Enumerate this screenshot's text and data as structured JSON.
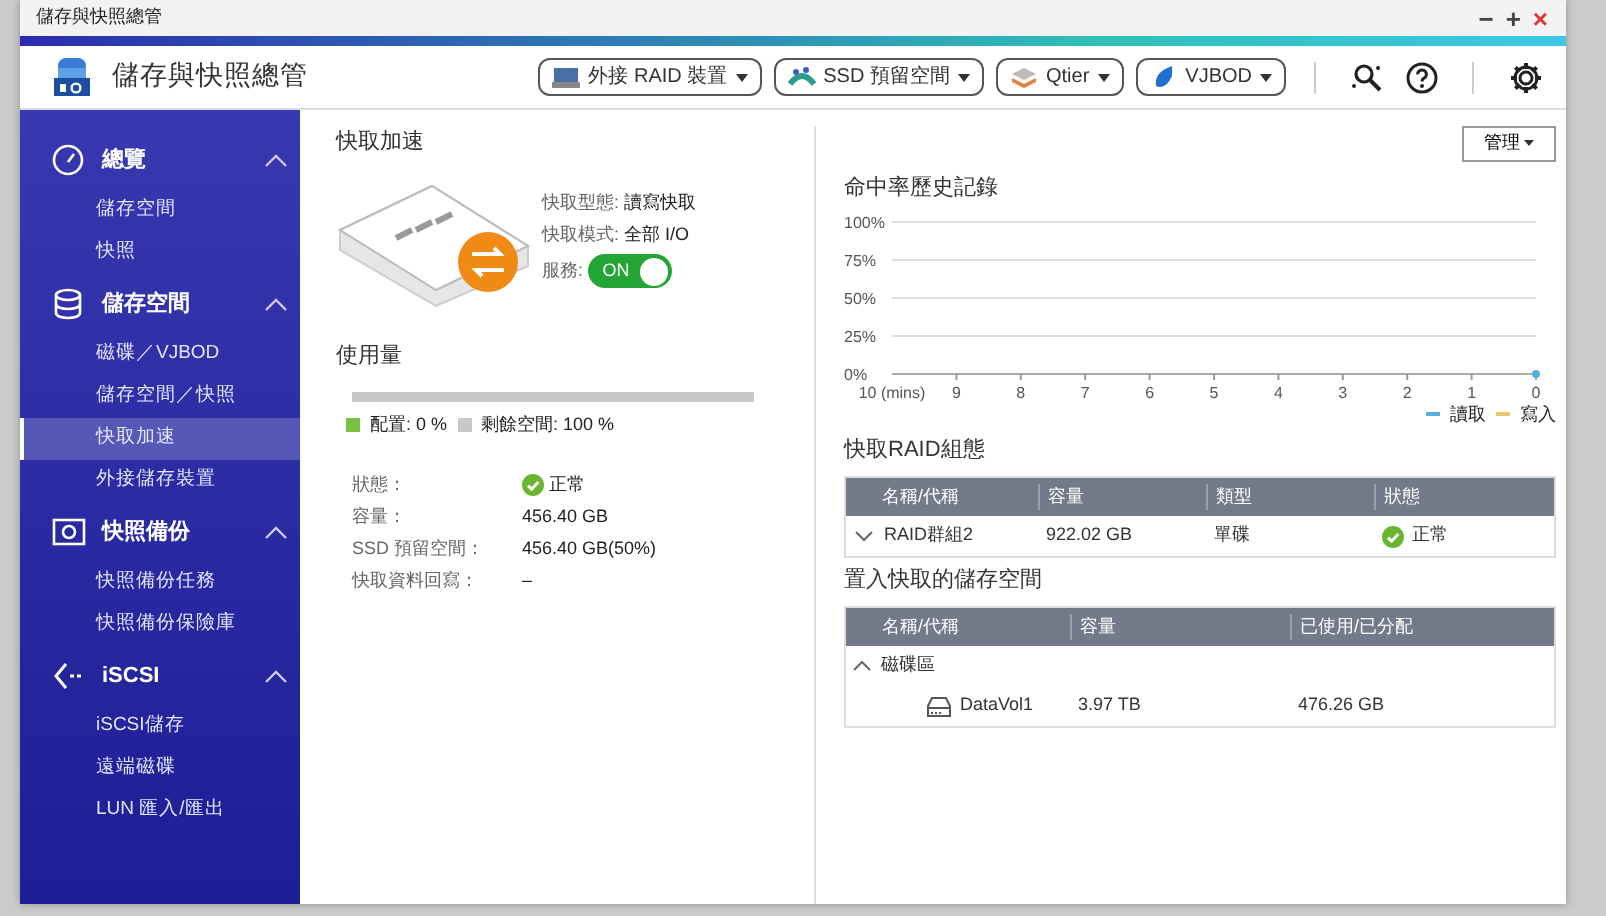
{
  "window": {
    "title": "儲存與快照總管",
    "controls": [
      "−",
      "+",
      "×"
    ]
  },
  "header": {
    "app_title": "儲存與快照總管",
    "menus": [
      {
        "label": "外接 RAID 裝置"
      },
      {
        "label": "SSD 預留空間"
      },
      {
        "label": "Qtier"
      },
      {
        "label": "VJBOD"
      }
    ]
  },
  "sidebar": {
    "sections": [
      {
        "label": "總覽",
        "expanded": true,
        "items": [
          {
            "label": "儲存空間",
            "selected": false
          },
          {
            "label": "快照",
            "selected": false
          }
        ]
      },
      {
        "label": "儲存空間",
        "expanded": true,
        "items": [
          {
            "label": "磁碟／VJBOD",
            "selected": false
          },
          {
            "label": "儲存空間／快照",
            "selected": false
          },
          {
            "label": "快取加速",
            "selected": true
          },
          {
            "label": "外接儲存裝置",
            "selected": false
          }
        ]
      },
      {
        "label": "快照備份",
        "expanded": true,
        "items": [
          {
            "label": "快照備份任務",
            "selected": false
          },
          {
            "label": "快照備份保險庫",
            "selected": false
          }
        ]
      },
      {
        "label": "iSCSI",
        "expanded": true,
        "items": [
          {
            "label": "iSCSI儲存",
            "selected": false
          },
          {
            "label": "遠端磁碟",
            "selected": false
          },
          {
            "label": "LUN 匯入/匯出",
            "selected": false
          }
        ]
      }
    ]
  },
  "main": {
    "title": "快取加速",
    "manage_button": "管理",
    "cache_info": [
      {
        "label": "快取型態:",
        "value": "讀寫快取",
        "kind": "text"
      },
      {
        "label": "快取模式:",
        "value": "全部 I/O",
        "kind": "text"
      },
      {
        "label": "服務:",
        "value": "ON",
        "kind": "toggle",
        "on": true
      }
    ],
    "usage": {
      "title": "使用量",
      "level": 0,
      "legend": [
        {
          "label": "配置:",
          "value": "0 %",
          "color": "#7ac142"
        },
        {
          "label": "剩餘空間:",
          "value": "100 %",
          "color": "#c8c8c8"
        }
      ]
    },
    "details": [
      {
        "label": "狀態：",
        "value": "正常",
        "kind": "status"
      },
      {
        "label": "容量：",
        "value": "456.40 GB",
        "kind": "text"
      },
      {
        "label": "SSD 預留空間：",
        "value": "456.40 GB(50%)",
        "kind": "text"
      },
      {
        "label": "快取資料回寫：",
        "value": "–",
        "kind": "text"
      }
    ],
    "hit_history": {
      "title": "命中率歷史記錄",
      "chart_data": {
        "type": "line",
        "categories": [
          "10 (mins)",
          "9",
          "8",
          "7",
          "6",
          "5",
          "4",
          "3",
          "2",
          "1",
          "0"
        ],
        "grid": true,
        "ylim": [
          0,
          100
        ],
        "yticks": [
          {
            "value": 0,
            "label": "0%"
          },
          {
            "value": 25,
            "label": "25%"
          },
          {
            "value": 50,
            "label": "50%"
          },
          {
            "value": 75,
            "label": "75%"
          },
          {
            "value": 100,
            "label": "100%"
          }
        ],
        "series": [
          {
            "name": "讀取",
            "color": "#5aaedc",
            "marker": true,
            "values": [
              null,
              null,
              null,
              null,
              null,
              null,
              null,
              null,
              null,
              null,
              0
            ]
          },
          {
            "name": "寫入",
            "color": "#e8c86a",
            "values": [
              null,
              null,
              null,
              null,
              null,
              null,
              null,
              null,
              null,
              null,
              null
            ]
          }
        ]
      }
    },
    "raid_table": {
      "title": "快取RAID組態",
      "columns": [
        "名稱/代稱",
        "容量",
        "類型",
        "狀態"
      ],
      "rows": [
        {
          "expanded": false,
          "cells": [
            "RAID群組2",
            "922.02 GB",
            "單碟",
            "正常"
          ]
        }
      ]
    },
    "volume_table": {
      "title": "置入快取的儲存空間",
      "columns": [
        "名稱/代稱",
        "容量",
        "已使用/已分配"
      ],
      "groups": [
        {
          "label": "磁碟區",
          "expanded": true,
          "rows": [
            {
              "cells": [
                "DataVol1",
                "3.97 TB",
                "476.26 GB"
              ]
            }
          ]
        }
      ]
    }
  }
}
